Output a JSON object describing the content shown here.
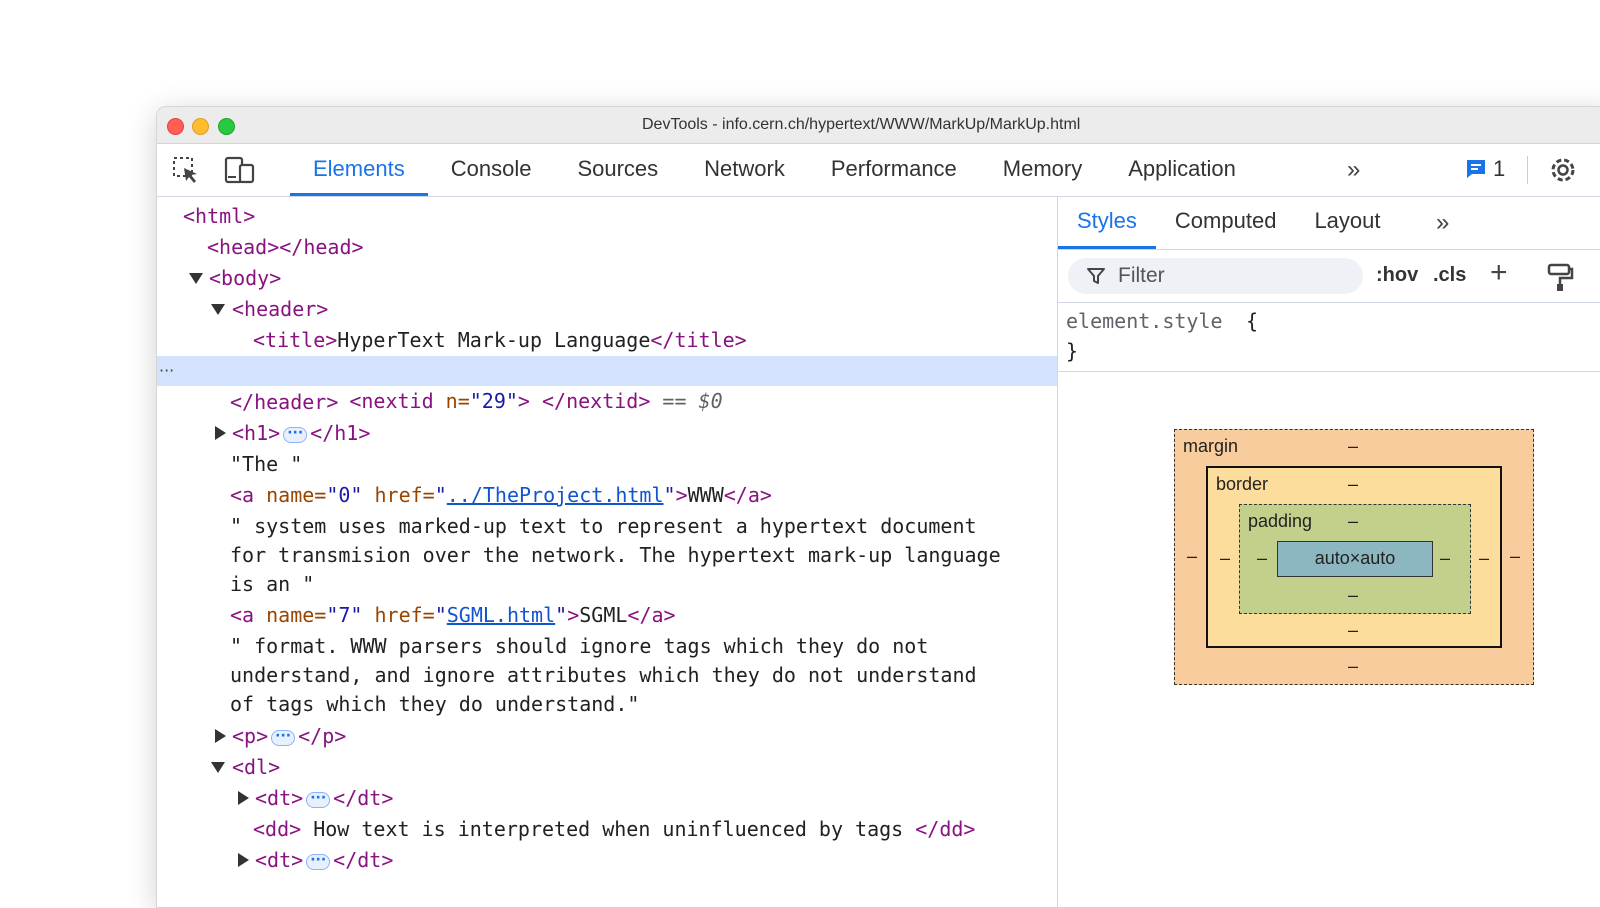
{
  "window": {
    "title": "DevTools - info.cern.ch/hypertext/WWW/MarkUp/MarkUp.html"
  },
  "toolbar": {
    "tabs": [
      "Elements",
      "Console",
      "Sources",
      "Network",
      "Performance",
      "Memory",
      "Application"
    ],
    "active_tab": "Elements",
    "more_tabs": "»",
    "issues_count": "1"
  },
  "dom_tree": {
    "html_open": "<html>",
    "head": "<head></head>",
    "body_open": "<body>",
    "header_open": "<header>",
    "title_open": "<title>",
    "title_text": "HyperText Mark-up Language",
    "title_close": "</title>",
    "nextid_open": "<nextid",
    "nextid_attr_name": " n=",
    "nextid_attr_value": "\"29\"",
    "nextid_rest": "> </nextid>",
    "selected_marker": " == ",
    "selected_var": "$0",
    "header_close": "</header>",
    "h1_open": "<h1>",
    "h1_close": "</h1>",
    "text_the": "\"The \"",
    "a1_open": "<a",
    "a1_name_attr": " name=",
    "a1_name_val": "\"0\"",
    "a1_href_attr": " href=",
    "a1_href_q1": "\"",
    "a1_href_link": "../TheProject.html",
    "a1_href_q2": "\"",
    "a1_gt": ">",
    "a1_text": "WWW",
    "a1_close": "</a>",
    "text_system_1": "\" system uses marked-up text to represent a hypertext document",
    "text_system_2": "for transmision over the network. The hypertext mark-up language",
    "text_system_3": "is an \"",
    "a2_open": "<a",
    "a2_name_attr": " name=",
    "a2_name_val": "\"7\"",
    "a2_href_attr": " href=",
    "a2_href_q1": "\"",
    "a2_href_link": "SGML.html",
    "a2_href_q2": "\"",
    "a2_gt": ">",
    "a2_text": "SGML",
    "a2_close": "</a>",
    "text_format_1": "\" format. WWW parsers should ignore tags which they do not",
    "text_format_2": "understand, and ignore attributes which they do not understand",
    "text_format_3": "of tags which they do understand.\"",
    "p_open": "<p>",
    "p_close": "</p>",
    "dl_open": "<dl>",
    "dt_open": "<dt>",
    "dt_close": "</dt>",
    "dd_open": "<dd>",
    "dd_text": " How text is interpreted when uninfluenced by tags ",
    "dd_close": "</dd>",
    "ellipsis": "···",
    "row_dots": "···"
  },
  "styles_pane": {
    "tabs": [
      "Styles",
      "Computed",
      "Layout"
    ],
    "active_tab": "Styles",
    "more_tabs": "»",
    "filter_placeholder": "Filter",
    "hov_label": ":hov",
    "cls_label": ".cls",
    "plus_label": "+",
    "rule_selector": "element.style",
    "rule_open": "{",
    "rule_close": "}"
  },
  "box_model": {
    "margin_label": "margin",
    "border_label": "border",
    "padding_label": "padding",
    "content_label": "auto×auto",
    "dash": "–"
  },
  "colors": {
    "accent": "#1a73e8",
    "tag": "#881280",
    "attr_name": "#994500",
    "attr_value": "#1a1aa6",
    "selected_row": "#d3e3fd",
    "margin_box": "#f9cc9d",
    "border_box": "#fddd9b",
    "padding_box": "#c3d08b",
    "content_box": "#8cb6c0"
  }
}
